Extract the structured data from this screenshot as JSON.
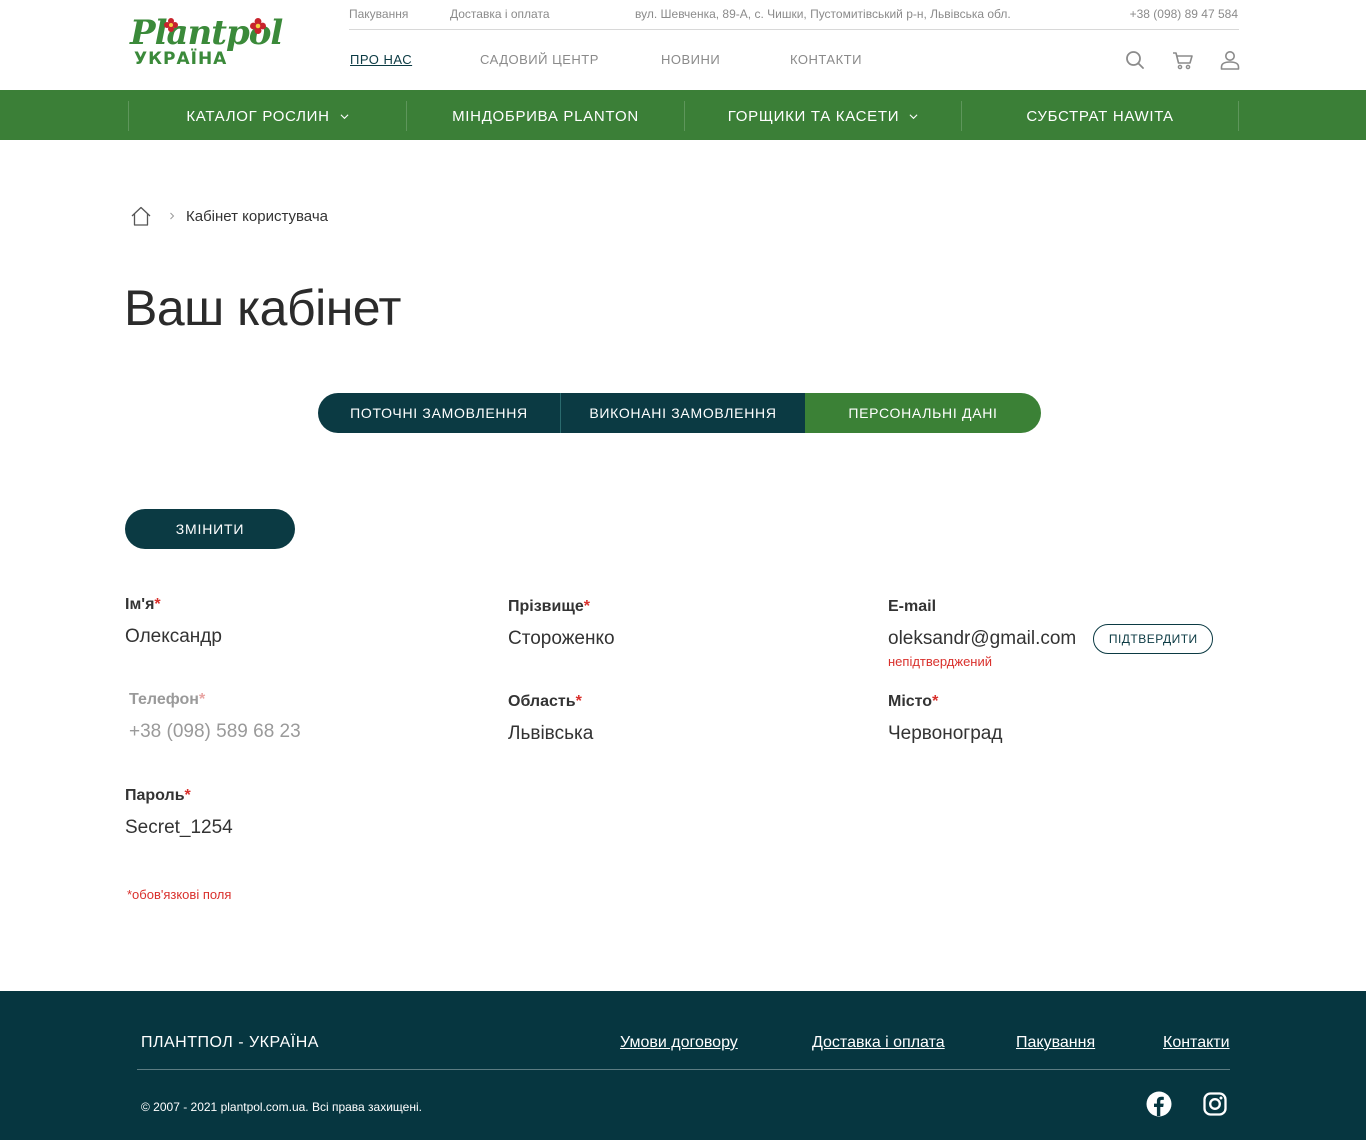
{
  "brand": {
    "logo_word": "Plantpol",
    "logo_sub": "УКРАЇНА",
    "colors": {
      "primary_dark": "#0b3a43",
      "green": "#3b7f37",
      "required": "#d9302c"
    }
  },
  "top_strip": {
    "packaging": "Пакування",
    "delivery": "Доставка і оплата",
    "address": "вул. Шевченка, 89-А, с. Чишки, Пустомитівський р-н, Львівська обл.",
    "phone": "+38 (098) 89 47 584"
  },
  "main_nav": {
    "about": "ПРО НАС",
    "garden_center": "САДОВИЙ ЦЕНТР",
    "news": "НОВИНИ",
    "contacts": "КОНТАКТИ"
  },
  "header_icons": [
    "search-icon",
    "cart-icon",
    "user-icon"
  ],
  "green_nav": {
    "catalog": "КАТАЛОГ РОСЛИН",
    "fertilizers": "МІНДОБРИВА PLANTON",
    "pots": "ГОРЩИКИ ТА КАСЕТИ",
    "substrate": "СУБСТРАТ HAWITA"
  },
  "breadcrumb": {
    "current": "Кабінет користувача"
  },
  "page_title": "Ваш кабінет",
  "tabs": {
    "current_orders": "ПОТОЧНІ ЗАМОВЛЕННЯ",
    "completed_orders": "ВИКОНАНІ ЗАМОВЛЕННЯ",
    "personal_data": "ПЕРСОНАЛЬНІ ДАНІ",
    "active": "personal_data"
  },
  "form": {
    "change_button": "ЗМІНИТИ",
    "required_mark": "*",
    "name": {
      "label": "Ім'я",
      "value": "Олександр"
    },
    "surname": {
      "label": "Прізвище",
      "value": "Стороженко"
    },
    "email": {
      "label": "E-mail",
      "value": "oleksandr@gmail.com",
      "confirm_button": "ПІДТВЕРДИТИ",
      "status": "непідтверджений"
    },
    "phone": {
      "label": "Телефон",
      "value": "+38 (098) 589 68 23"
    },
    "region": {
      "label": "Область",
      "value": "Львівська"
    },
    "city": {
      "label": "Місто",
      "value": "Червоноград"
    },
    "password": {
      "label": "Пароль",
      "value": "Secret_1254"
    },
    "required_note": "*обов'язкові поля"
  },
  "footer": {
    "brand": "ПЛАНТПОЛ - УКРАЇНА",
    "links": {
      "terms": "Умови договору",
      "delivery": "Доставка і оплата",
      "packaging": "Пакування",
      "contacts": "Контакти"
    },
    "copyright": "© 2007 - 2021 plantpol.com.ua. Всі права захищені.",
    "social": [
      "facebook-icon",
      "instagram-icon"
    ]
  }
}
